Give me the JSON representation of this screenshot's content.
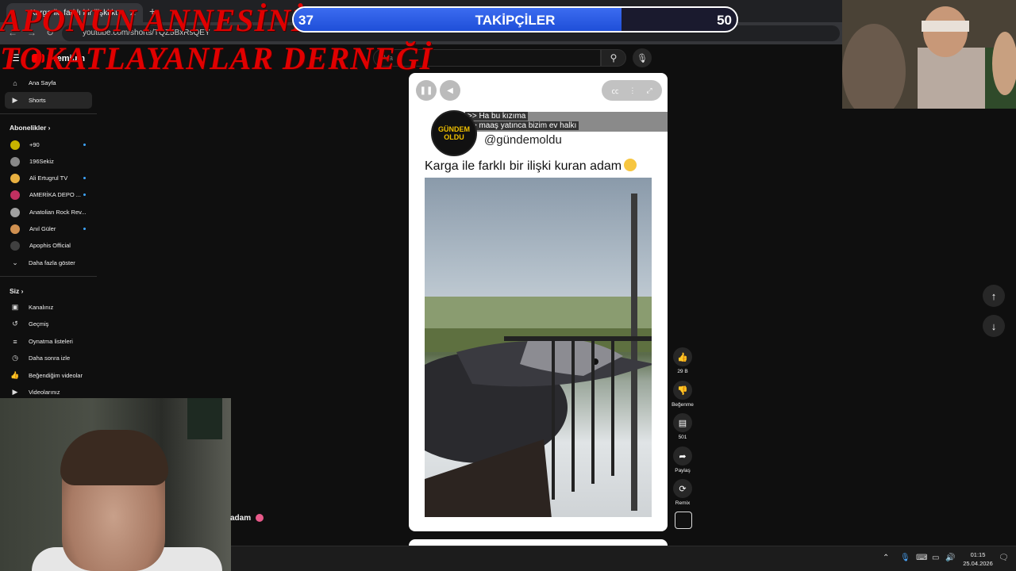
{
  "browser": {
    "tab_title": "Karga ile farklı bir ilişki kuran",
    "url": "youtube.com/shorts/TQZ5BxRsQEY"
  },
  "youtube": {
    "logo_text": "Premium",
    "search_placeholder": "Ara"
  },
  "sidebar": {
    "home": "Ana Sayfa",
    "shorts": "Shorts",
    "subscriptions_heading": "Abonelikler",
    "channels": [
      {
        "name": "+90",
        "color": "#c8b400"
      },
      {
        "name": "196Sekiz",
        "color": "#888888"
      },
      {
        "name": "Ali Ertugrul TV",
        "color": "#e8b040"
      },
      {
        "name": "AMERİKA DEPO ...",
        "color": "#c03060"
      },
      {
        "name": "Anatolian Rock Rev...",
        "color": "#a0a0a0"
      },
      {
        "name": "Anıl Güler",
        "color": "#d09050"
      },
      {
        "name": "Apophis Official",
        "color": "#404040"
      }
    ],
    "show_more": "Daha fazla göster",
    "you_heading": "Siz",
    "you_items": [
      {
        "label": "Kanalınız",
        "icon": "channel-icon"
      },
      {
        "label": "Geçmiş",
        "icon": "history-icon"
      },
      {
        "label": "Oynatma listeleri",
        "icon": "playlist-icon"
      },
      {
        "label": "Daha sonra izle",
        "icon": "clock-icon"
      },
      {
        "label": "Beğendiğim videolar",
        "icon": "thumbs-up-icon"
      },
      {
        "label": "Videolarınız",
        "icon": "video-icon"
      }
    ]
  },
  "overlay": {
    "line1": "APONUN ANNESİNİ",
    "line2": "TOKATLAYANLAR DERNEĞİ"
  },
  "followers": {
    "current": "37",
    "goal": "50",
    "label": "TAKİPÇİLER",
    "progress": 0.74
  },
  "short": {
    "channel_logo_text": "GÜNDEM OLDU",
    "subtitle_line1": ">> Ha bu kızıma",
    "subtitle_line2": ">> maaş yatınca bizim ev halkı",
    "handle": "@gündemoldu",
    "caption": "Karga ile farklı bir ilişki kuran adam"
  },
  "actions": {
    "likes": "29 B",
    "dislike": "Beğenme",
    "comments": "501",
    "share": "Paylaş",
    "remix": "Remix"
  },
  "background_caption": "adam",
  "taskbar": {
    "time": "01:15",
    "date": "25.04.2026"
  }
}
